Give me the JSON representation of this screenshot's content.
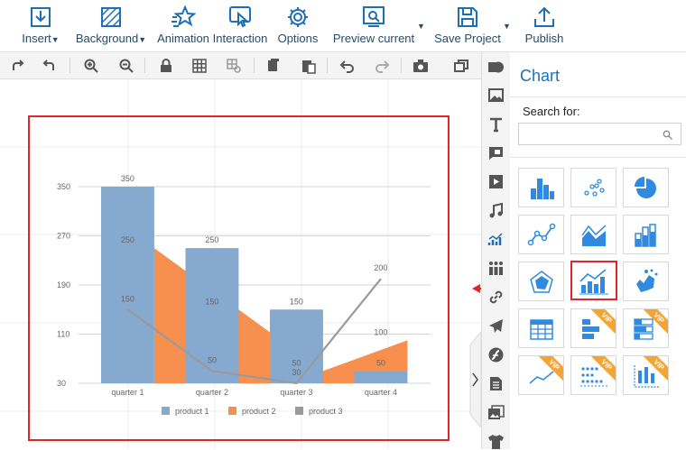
{
  "toolbar": {
    "insert": "Insert",
    "background": "Background",
    "animation": "Animation",
    "interaction": "Interaction",
    "options": "Options",
    "preview": "Preview current",
    "save": "Save Project",
    "publish": "Publish"
  },
  "panel": {
    "title": "Chart",
    "search_label": "Search for:",
    "search_value": "",
    "vip_badge": "VIP"
  },
  "colors": {
    "accent": "#1873b8",
    "icon": "#1e6eb5",
    "highlight": "#e0252b",
    "vip": "#f2a534"
  },
  "chart_data": {
    "type": "bar",
    "categories": [
      "quarter 1",
      "quarter 2",
      "quarter 3",
      "quarter 4"
    ],
    "series": [
      {
        "name": "product 1",
        "kind": "bar",
        "color": "#85a9cf",
        "values": [
          350,
          250,
          150,
          50
        ]
      },
      {
        "name": "product 2",
        "kind": "area",
        "color": "#f7904f",
        "values": [
          250,
          150,
          50,
          100
        ]
      },
      {
        "name": "product 3",
        "kind": "line",
        "color": "#9a9a9a",
        "values": [
          150,
          50,
          30,
          200
        ]
      }
    ],
    "y_ticks": [
      30,
      110,
      190,
      270,
      350
    ],
    "ylim": [
      30,
      350
    ],
    "grid": true,
    "legend": "bottom"
  }
}
